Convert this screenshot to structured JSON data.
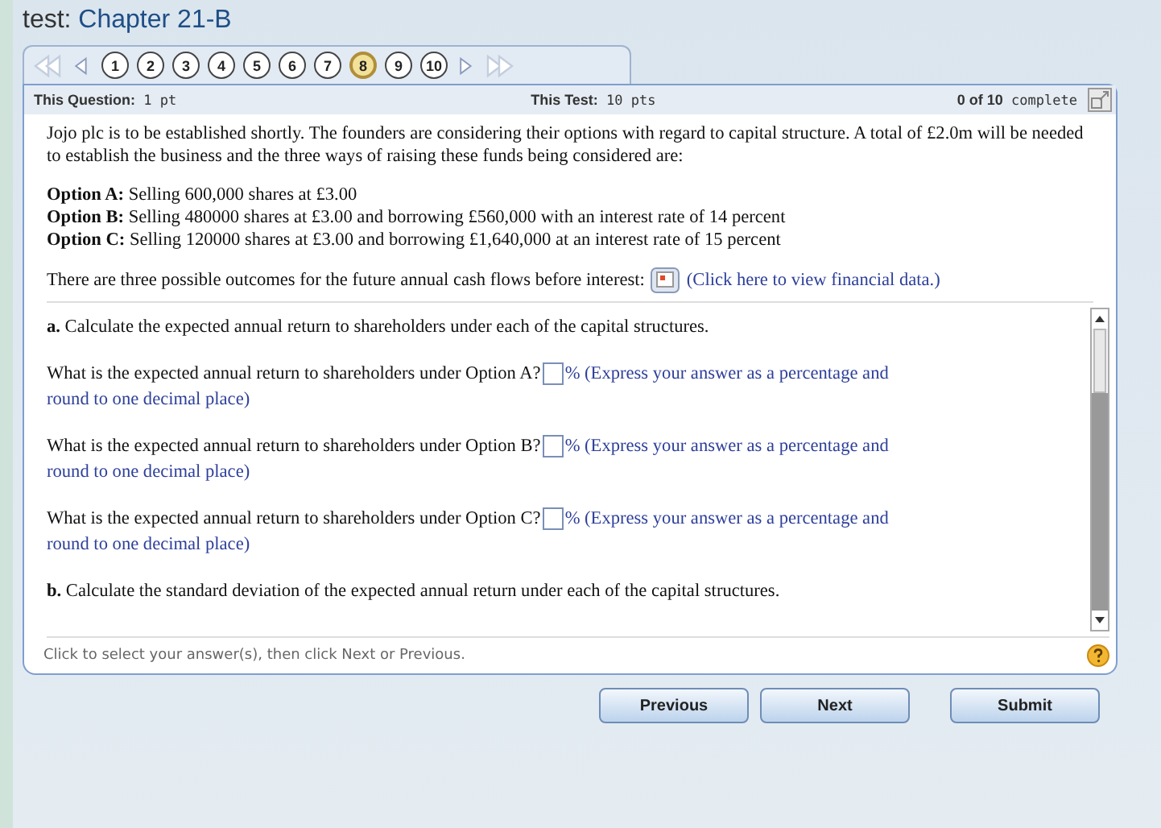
{
  "title": {
    "prefix": "test:",
    "name": "Chapter 21-B"
  },
  "nav": {
    "arrows": [
      {
        "kind": "first",
        "disabled": true
      },
      {
        "kind": "prev",
        "disabled": false
      }
    ],
    "questions": [
      {
        "label": "1",
        "selected": false
      },
      {
        "label": "2",
        "selected": false
      },
      {
        "label": "3",
        "selected": false
      },
      {
        "label": "4",
        "selected": false
      },
      {
        "label": "5",
        "selected": false
      },
      {
        "label": "6",
        "selected": false
      },
      {
        "label": "7",
        "selected": false
      },
      {
        "label": "8",
        "selected": true
      },
      {
        "label": "9",
        "selected": false
      },
      {
        "label": "10",
        "selected": false
      }
    ],
    "arrows_after": [
      {
        "kind": "next",
        "disabled": false
      },
      {
        "kind": "last",
        "disabled": true
      }
    ]
  },
  "info": {
    "question_label": "This Question:",
    "question_value": "1 pt",
    "test_label": "This Test:",
    "test_value": "10 pts",
    "complete_count": "0 of 10",
    "complete_word": "complete"
  },
  "intro": "Jojo plc is to be established shortly. The founders are considering their options with regard to capital structure. A total of £2.0m will be needed to establish the business and the three ways of raising these funds being considered are:",
  "options": [
    {
      "label": "Option A:",
      "text": "Selling 600,000 shares at £3.00"
    },
    {
      "label": "Option B:",
      "text": "Selling 480000 shares at £3.00 and borrowing £560,000 with an interest rate of 14 percent"
    },
    {
      "label": "Option C:",
      "text": "Selling 120000 shares at £3.00 and borrowing £1,640,000 at an interest rate of 15 percent"
    }
  ],
  "data_line": {
    "text": "There are three possible outcomes for the future annual cash flows before interest:",
    "link": "(Click here to view financial data.)"
  },
  "parts": [
    {
      "kind": "heading",
      "label": "a.",
      "text": "Calculate the expected annual return to shareholders under each of the capital structures."
    },
    {
      "kind": "question",
      "text": "What is the expected annual return to shareholders under Option A?",
      "unit": "%",
      "hint": "(Express your answer as a percentage and",
      "hint_continued": "round to one decimal place)"
    },
    {
      "kind": "question",
      "text": "What is the expected annual return to shareholders under Option B?",
      "unit": "%",
      "hint": "(Express your answer as a percentage and",
      "hint_continued": "round to one decimal place)"
    },
    {
      "kind": "question",
      "text": "What is the expected annual return to shareholders under Option C?",
      "unit": "%",
      "hint": "(Express your answer as a percentage and",
      "hint_continued": "round to one decimal place)"
    },
    {
      "kind": "heading",
      "label": "b.",
      "text": "Calculate the standard deviation of the expected annual return under each of the capital structures."
    }
  ],
  "footer": "Click to select your answer(s), then click Next or Previous.",
  "buttons": [
    "Previous",
    "Next",
    "Submit"
  ]
}
